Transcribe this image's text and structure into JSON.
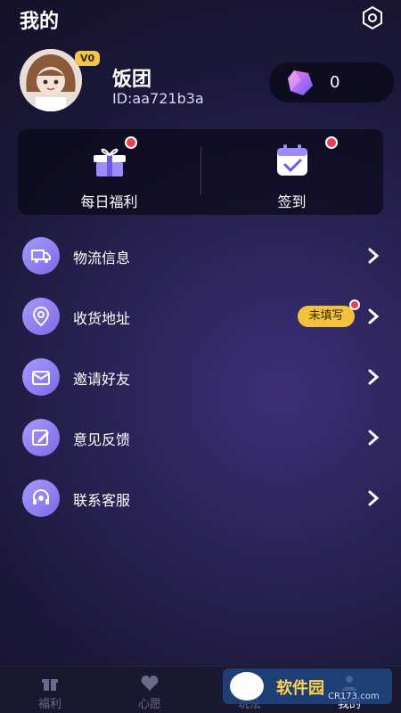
{
  "header": {
    "title": "我的",
    "settings_icon": "gear-hex-icon"
  },
  "profile": {
    "nickname": "饭团",
    "user_id": "ID:aa721b3a",
    "vip_badge": "V0",
    "gem_count": "0"
  },
  "quick_actions": [
    {
      "label": "每日福利",
      "icon": "gift-icon",
      "has_dot": true
    },
    {
      "label": "签到",
      "icon": "calendar-check-icon",
      "has_dot": true
    }
  ],
  "menu": [
    {
      "label": "物流信息",
      "icon": "truck-icon"
    },
    {
      "label": "收货地址",
      "icon": "location-pin-icon",
      "badge": "未填写"
    },
    {
      "label": "邀请好友",
      "icon": "invite-mail-icon"
    },
    {
      "label": "意见反馈",
      "icon": "edit-icon"
    },
    {
      "label": "联系客服",
      "icon": "headset-icon"
    }
  ],
  "tabs": [
    {
      "label": "福利",
      "icon": "gift-icon"
    },
    {
      "label": "心愿",
      "icon": "heart-icon"
    },
    {
      "label": "玩法",
      "icon": "game-icon"
    },
    {
      "label": "我的",
      "icon": "user-icon",
      "active": true
    }
  ],
  "watermark": {
    "brand": "软件园",
    "domain": "CR173.com"
  }
}
